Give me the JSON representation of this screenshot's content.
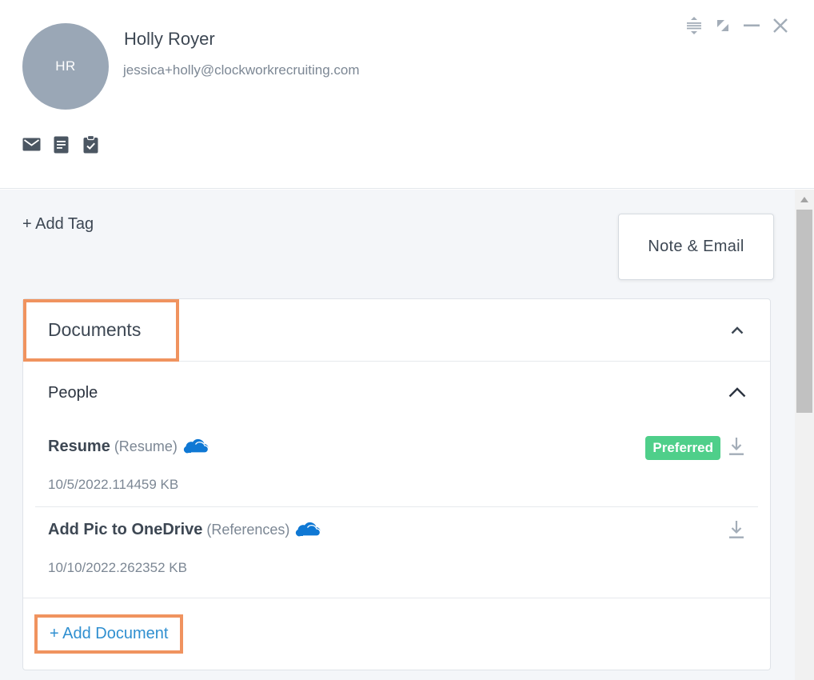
{
  "person": {
    "initials": "HR",
    "name": "Holly Royer",
    "email": "jessica+holly@clockworkrecruiting.com",
    "avatar_color": "#9aa7b6"
  },
  "quick_actions": [
    "email-icon",
    "document-icon",
    "clipboard-check-icon"
  ],
  "window_controls": [
    "expand-vertical-icon",
    "restore-icon",
    "minimize-icon",
    "close-icon"
  ],
  "panel": {
    "add_tag": "+ Add Tag",
    "note_email": "Note & Email"
  },
  "documents": {
    "title": "Documents",
    "section_label": "People",
    "items": [
      {
        "name": "Resume",
        "type": "(Resume)",
        "meta": "10/5/2022.114459 KB",
        "badge": "Preferred",
        "storage_icon": "onedrive-cloud-icon"
      },
      {
        "name": "Add Pic to OneDrive",
        "type": "(References)",
        "meta": "10/10/2022.262352 KB",
        "storage_icon": "onedrive-cloud-icon"
      }
    ],
    "add_label": "+ Add Document"
  },
  "colors": {
    "accent_link": "#2f8fd0",
    "preferred_badge": "#4fcf8a",
    "highlight": "#f0935f",
    "onedrive": "#0f78d4"
  }
}
